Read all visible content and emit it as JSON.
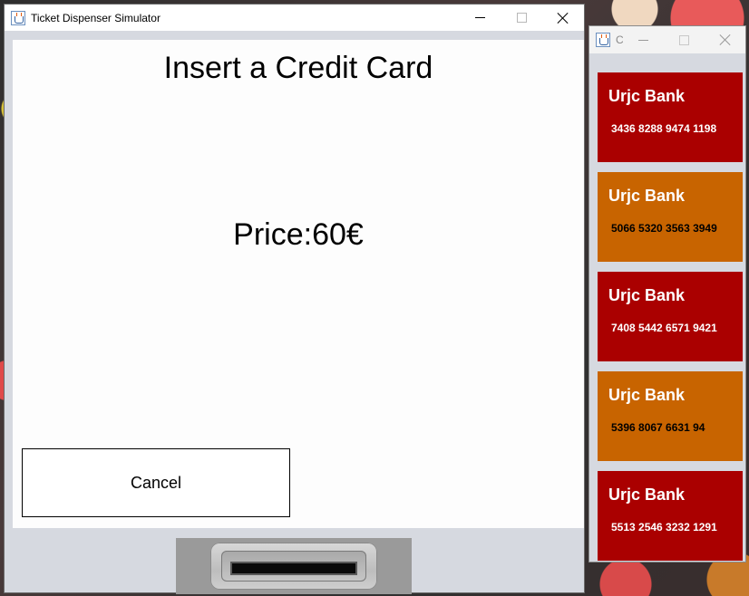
{
  "main_window": {
    "title": "Ticket Dispenser Simulator",
    "heading": "Insert a Credit Card",
    "price": "Price:60€",
    "cancel_label": "Cancel"
  },
  "side_window": {
    "title": "C",
    "cards": [
      {
        "bank": "Urjc Bank",
        "number": "3436 8288 9474 1198",
        "color": "#aa0000"
      },
      {
        "bank": "Urjc Bank",
        "number": "5066 5320 3563 3949",
        "color": "#c86400"
      },
      {
        "bank": "Urjc Bank",
        "number": "7408 5442 6571 9421",
        "color": "#aa0000"
      },
      {
        "bank": "Urjc Bank",
        "number": "5396 8067 6631 94",
        "color": "#c86400"
      },
      {
        "bank": "Urjc Bank",
        "number": "5513 2546 3232 1291",
        "color": "#aa0000"
      }
    ]
  },
  "colors": {
    "window_background": "#d6d9e0",
    "panel_background": "#fdfdfd",
    "card_red": "#aa0000",
    "card_orange": "#c86400"
  },
  "icons": {
    "app": "java-coffee-cup-icon",
    "minimize": "minimize-icon",
    "maximize": "maximize-icon",
    "close": "close-icon"
  }
}
